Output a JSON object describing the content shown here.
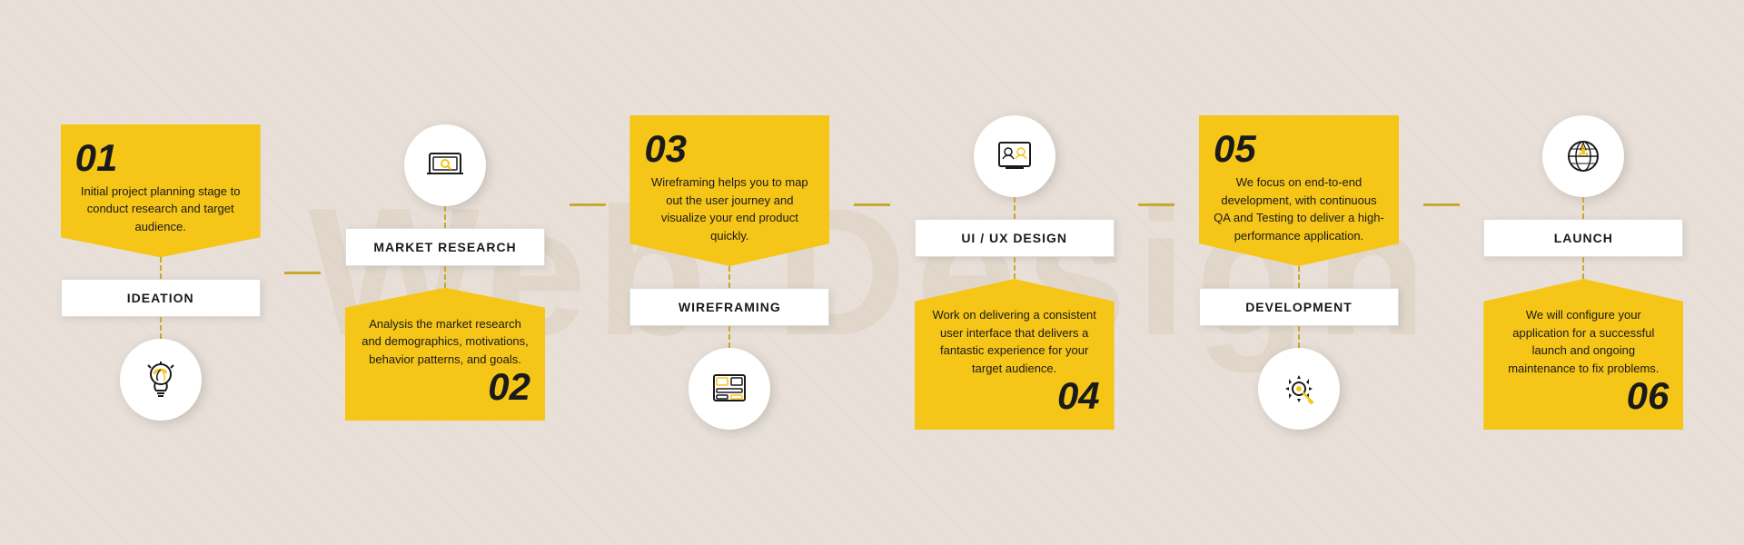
{
  "bg_text": "Web Design",
  "steps": [
    {
      "id": "01",
      "label": "IDEATION",
      "description": "Initial project planning stage to conduct research and target audience.",
      "position": "top",
      "icon": "lightbulb"
    },
    {
      "id": "02",
      "label": "MARKET RESEARCH",
      "description": "Analysis the market research and demographics, motivations, behavior patterns, and goals.",
      "position": "bottom",
      "icon": "laptop-search"
    },
    {
      "id": "03",
      "label": "WIREFRAMING",
      "description": "Wireframing helps you to map out the user journey and visualize your end product quickly.",
      "position": "top",
      "icon": "wireframe"
    },
    {
      "id": "04",
      "label": "UI / UX DESIGN",
      "description": "Work on delivering a consistent user interface that delivers a fantastic experience for your target audience.",
      "position": "bottom",
      "icon": "ux-design"
    },
    {
      "id": "05",
      "label": "DEVELOPMENT",
      "description": "We focus on end-to-end development, with continuous QA and Testing to deliver a high-performance application.",
      "position": "top",
      "icon": "gear-code"
    },
    {
      "id": "06",
      "label": "LAUNCH",
      "description": "We will configure your application for a successful launch and ongoing maintenance to fix problems.",
      "position": "bottom",
      "icon": "rocket"
    }
  ]
}
